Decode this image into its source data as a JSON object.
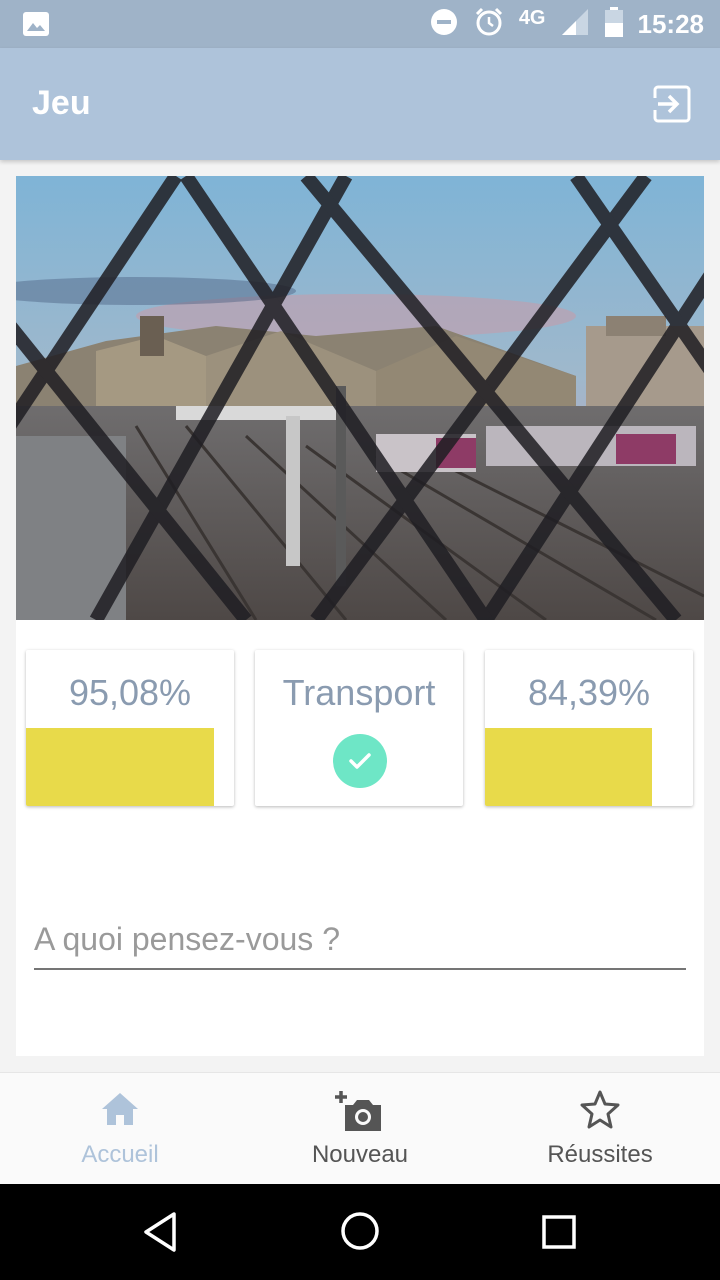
{
  "status_bar": {
    "time": "15:28",
    "network": "4G",
    "icons": [
      "image-icon",
      "dnd-icon",
      "alarm-icon",
      "signal-icon",
      "battery-icon"
    ]
  },
  "app_bar": {
    "title": "Jeu",
    "exit_icon": "exit-icon"
  },
  "game": {
    "photo_description": "train-station-behind-fence",
    "stats": [
      {
        "value": "95,08%",
        "level": 0.9508
      },
      {
        "value": "Transport",
        "status": "correct"
      },
      {
        "value": "84,39%",
        "level": 0.8439
      }
    ],
    "input": {
      "placeholder": "A quoi pensez-vous ?",
      "value": ""
    }
  },
  "bottom_nav": {
    "items": [
      {
        "label": "Accueil",
        "icon": "home-icon",
        "active": true
      },
      {
        "label": "Nouveau",
        "icon": "add-camera-icon",
        "active": false
      },
      {
        "label": "Réussites",
        "icon": "star-icon",
        "active": false
      }
    ]
  },
  "colors": {
    "app_bar": "#aec3da",
    "status_bar": "#9fb3c8",
    "bar_fill": "#e8da4a",
    "check": "#6ee6c6",
    "stat_text": "#8a9bb0",
    "nav_active": "#aec3da",
    "nav_inactive": "#555555"
  }
}
